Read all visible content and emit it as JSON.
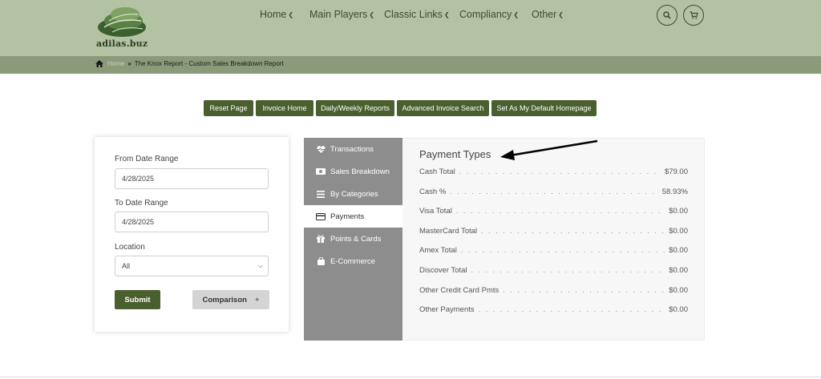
{
  "header": {
    "logo_text": "adilas.buz",
    "nav": [
      {
        "label": "Home"
      },
      {
        "label": "Main Players"
      },
      {
        "label": "Classic Links"
      },
      {
        "label": "Compliancy"
      },
      {
        "label": "Other"
      }
    ],
    "icons": [
      "search-icon",
      "cart-icon"
    ]
  },
  "breadcrumb": {
    "home": "Home",
    "current": "The Knox Report - Custom Sales Breakdown Report"
  },
  "buttons": [
    {
      "label": "Reset Page"
    },
    {
      "label": "Invoice Home"
    },
    {
      "label": "Daily/Weekly Reports"
    },
    {
      "label": "Advanced Invoice Search"
    },
    {
      "label": "Set As My Default Homepage"
    }
  ],
  "form": {
    "from_label": "From Date Range",
    "from_value": "4/28/2025",
    "to_label": "To Date Range",
    "to_value": "4/28/2025",
    "location_label": "Location",
    "location_value": "All",
    "submit_label": "Submit",
    "comparison_label": "Comparison",
    "comparison_plus": "+"
  },
  "tabs": [
    {
      "label": "Transactions",
      "icon": "heartbeat-icon"
    },
    {
      "label": "Sales Breakdown",
      "icon": "money-icon"
    },
    {
      "label": "By Categories",
      "icon": "list-icon"
    },
    {
      "label": "Payments",
      "icon": "credit-card-icon",
      "active": true
    },
    {
      "label": "Points & Cards",
      "icon": "gift-icon"
    },
    {
      "label": "E-Commerce",
      "icon": "shopping-bag-icon"
    }
  ],
  "payments": {
    "title": "Payment Types",
    "rows": [
      {
        "label": "Cash Total",
        "value": "$79.00"
      },
      {
        "label": "Cash %",
        "value": "58.93%"
      },
      {
        "label": "Visa Total",
        "value": "$0.00"
      },
      {
        "label": "MasterCard Total",
        "value": "$0.00"
      },
      {
        "label": "Amex Total",
        "value": "$0.00"
      },
      {
        "label": "Discover Total",
        "value": "$0.00"
      },
      {
        "label": "Other Credit Card Pmts",
        "value": "$0.00"
      },
      {
        "label": "Other Payments",
        "value": "$0.00"
      }
    ]
  },
  "colors": {
    "header_bg": "#b3c2a3",
    "breadcrumb_bg": "#8b9b7a",
    "button_green": "#4a5f2e",
    "tab_gray": "#8d8d8d"
  }
}
